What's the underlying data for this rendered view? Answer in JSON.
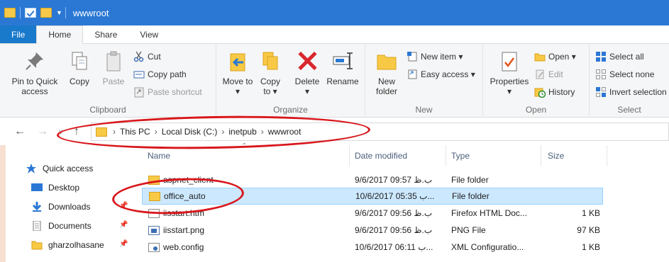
{
  "window": {
    "title": "wwwroot"
  },
  "tabs": [
    {
      "label": "File"
    },
    {
      "label": "Home"
    },
    {
      "label": "Share"
    },
    {
      "label": "View"
    }
  ],
  "ribbon": {
    "clipboard": {
      "label": "Clipboard",
      "pin": "Pin to Quick access",
      "copy": "Copy",
      "paste": "Paste",
      "cut": "Cut",
      "copy_path": "Copy path",
      "paste_shortcut": "Paste shortcut"
    },
    "organize": {
      "label": "Organize",
      "move_to": "Move to",
      "copy_to": "Copy to",
      "delete": "Delete",
      "rename": "Rename"
    },
    "new": {
      "label": "New",
      "new_folder": "New folder",
      "new_item": "New item",
      "easy_access": "Easy access"
    },
    "open": {
      "label": "Open",
      "properties": "Properties",
      "open": "Open",
      "edit": "Edit",
      "history": "History"
    },
    "select": {
      "label": "Select",
      "select_all": "Select all",
      "select_none": "Select none",
      "invert": "Invert selection"
    }
  },
  "address": {
    "crumbs": [
      "This PC",
      "Local Disk (C:)",
      "inetpub",
      "wwwroot"
    ]
  },
  "navpane": {
    "items": [
      {
        "label": "Quick access",
        "icon": "star-icon"
      },
      {
        "label": "Desktop",
        "icon": "desktop-icon"
      },
      {
        "label": "Downloads",
        "icon": "download-icon"
      },
      {
        "label": "Documents",
        "icon": "documents-icon"
      },
      {
        "label": "gharzolhasane",
        "icon": "folder-icon"
      }
    ]
  },
  "filelist": {
    "columns": [
      "Name",
      "Date modified",
      "Type",
      "Size"
    ],
    "rows": [
      {
        "name": "aspnet_client",
        "date": "9/6/2017 09:57 ب.ظ",
        "type": "File folder",
        "size": "",
        "icon": "folder"
      },
      {
        "name": "office_auto",
        "date": "10/6/2017 05:35 ب...",
        "type": "File folder",
        "size": "",
        "icon": "folder"
      },
      {
        "name": "iisstart.htm",
        "date": "9/6/2017 09:56 ب.ظ",
        "type": "Firefox HTML Doc...",
        "size": "1 KB",
        "icon": "htm"
      },
      {
        "name": "iisstart.png",
        "date": "9/6/2017 09:56 ب.ظ",
        "type": "PNG File",
        "size": "97 KB",
        "icon": "png"
      },
      {
        "name": "web.config",
        "date": "10/6/2017 06:11 ب...",
        "type": "XML Configuratio...",
        "size": "1 KB",
        "icon": "cfg"
      }
    ]
  },
  "colors": {
    "titlebar": "#2b78d4",
    "selection": "#cce8ff",
    "annotation": "#d8171c"
  }
}
